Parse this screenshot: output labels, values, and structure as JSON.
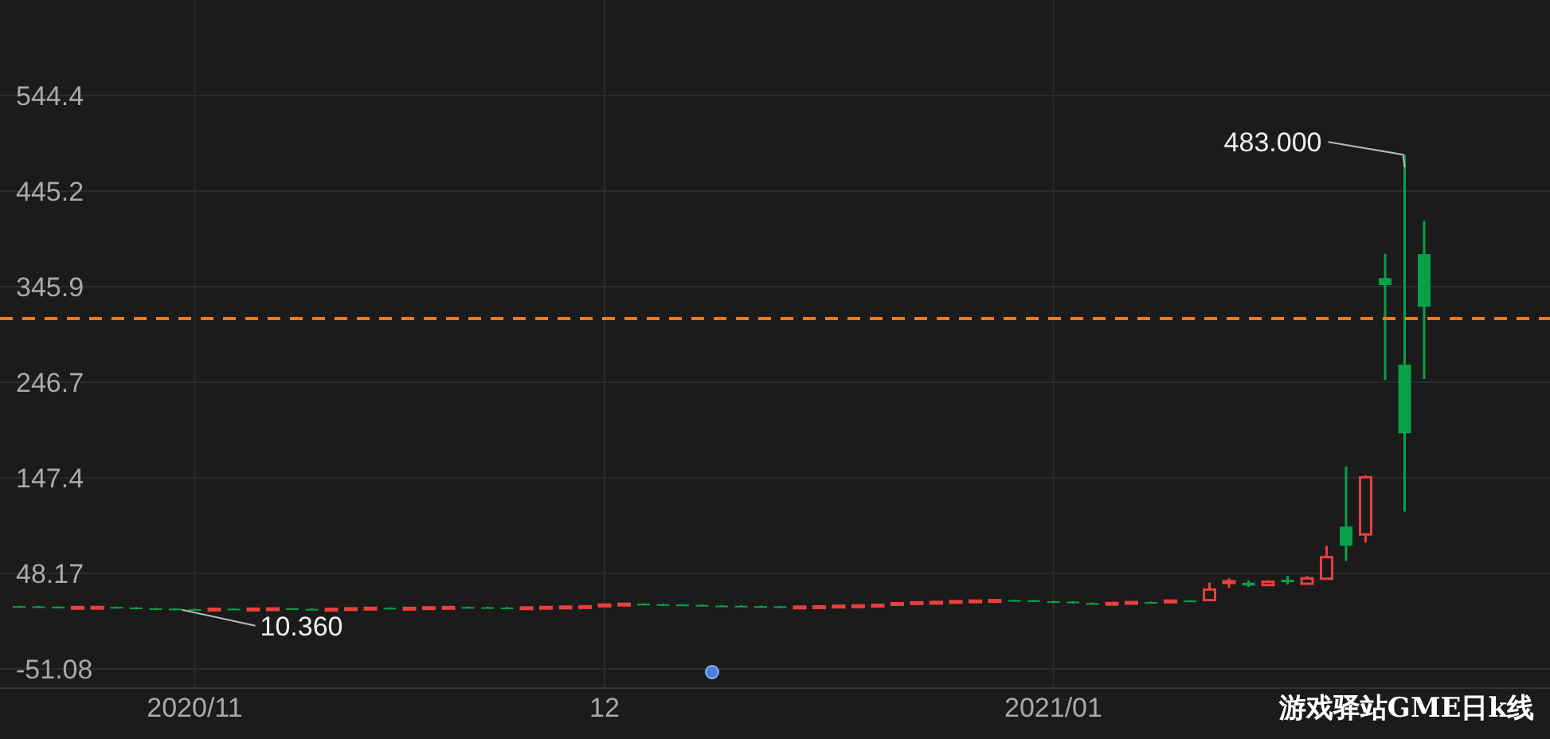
{
  "chart": {
    "chart_data": {
      "type": "candlestick",
      "ylim": [
        -70.9,
        643.6
      ],
      "grid": true,
      "categories": [
        null,
        null,
        null,
        null,
        null,
        null,
        null,
        null,
        null,
        "2020/11",
        null,
        null,
        null,
        null,
        null,
        null,
        null,
        null,
        null,
        null,
        null,
        null,
        null,
        null,
        null,
        null,
        null,
        null,
        null,
        null,
        "12",
        null,
        null,
        null,
        null,
        null,
        null,
        null,
        null,
        null,
        null,
        null,
        null,
        null,
        null,
        null,
        null,
        null,
        null,
        null,
        null,
        null,
        null,
        "2021/01",
        null,
        null,
        null,
        null,
        null,
        null,
        null,
        null,
        null,
        null,
        null,
        null,
        null,
        null,
        null,
        null,
        null,
        null,
        null
      ],
      "yticks": [
        {
          "value": 544.4,
          "label": "544.4"
        },
        {
          "value": 445.2,
          "label": "445.2"
        },
        {
          "value": 345.9,
          "label": "345.9"
        },
        {
          "value": 246.7,
          "label": "246.7"
        },
        {
          "value": 147.4,
          "label": "147.4"
        },
        {
          "value": 48.17,
          "label": "48.17"
        },
        {
          "value": -51.08,
          "label": "-51.08"
        }
      ],
      "series": [
        {
          "ohlc": [
            [
              14.2,
              14.7,
              13.4,
              13.9
            ],
            [
              13.9,
              14.4,
              13.1,
              13.6
            ],
            [
              13.6,
              14.1,
              12.5,
              13.0
            ],
            [
              13.0,
              13.7,
              12.5,
              13.2
            ],
            [
              13.2,
              13.8,
              12.7,
              13.3
            ],
            [
              13.3,
              13.8,
              12.2,
              12.7
            ],
            [
              12.7,
              13.2,
              11.3,
              11.8
            ],
            [
              11.8,
              12.3,
              11.0,
              11.5
            ],
            [
              11.5,
              12.0,
              10.5,
              11.0
            ],
            [
              11.0,
              11.5,
              10.36,
              10.9
            ],
            [
              10.9,
              11.9,
              10.4,
              11.4
            ],
            [
              11.4,
              11.9,
              10.7,
              11.2
            ],
            [
              11.2,
              12.0,
              10.7,
              11.5
            ],
            [
              11.5,
              12.3,
              11.0,
              11.8
            ],
            [
              11.8,
              12.3,
              10.8,
              11.3
            ],
            [
              11.3,
              11.8,
              10.5,
              11.0
            ],
            [
              11.0,
              11.8,
              10.5,
              11.3
            ],
            [
              11.3,
              12.4,
              10.8,
              11.9
            ],
            [
              11.9,
              12.9,
              11.4,
              12.4
            ],
            [
              12.4,
              12.9,
              11.5,
              12.0
            ],
            [
              12.0,
              12.8,
              11.5,
              12.3
            ],
            [
              12.3,
              13.4,
              11.8,
              12.9
            ],
            [
              12.9,
              13.7,
              12.4,
              13.2
            ],
            [
              13.2,
              13.7,
              12.5,
              13.0
            ],
            [
              13.0,
              13.5,
              12.2,
              12.7
            ],
            [
              12.7,
              13.2,
              12.0,
              12.5
            ],
            [
              12.5,
              13.3,
              12.0,
              12.8
            ],
            [
              12.8,
              13.8,
              12.3,
              13.3
            ],
            [
              13.3,
              14.1,
              12.8,
              13.6
            ],
            [
              13.6,
              14.5,
              13.1,
              14.0
            ],
            [
              14.0,
              16.3,
              13.5,
              15.8
            ],
            [
              15.8,
              17.1,
              15.3,
              16.6
            ],
            [
              16.6,
              17.1,
              15.6,
              16.1
            ],
            [
              16.1,
              16.6,
              15.3,
              15.8
            ],
            [
              15.8,
              16.3,
              14.9,
              15.4
            ],
            [
              15.4,
              15.9,
              14.2,
              14.7
            ],
            [
              14.7,
              15.2,
              14.0,
              14.5
            ],
            [
              14.5,
              15.0,
              13.7,
              14.2
            ],
            [
              14.2,
              14.7,
              13.4,
              13.9
            ],
            [
              13.9,
              14.4,
              13.0,
              13.5
            ],
            [
              13.5,
              14.1,
              13.0,
              13.6
            ],
            [
              13.6,
              14.4,
              13.1,
              13.9
            ],
            [
              13.9,
              15.1,
              13.4,
              14.6
            ],
            [
              14.6,
              15.4,
              14.1,
              14.9
            ],
            [
              14.9,
              16.0,
              14.4,
              15.5
            ],
            [
              15.5,
              17.7,
              15.0,
              17.2
            ],
            [
              17.2,
              18.6,
              16.7,
              18.1
            ],
            [
              18.1,
              19.0,
              17.6,
              18.5
            ],
            [
              18.5,
              19.9,
              18.0,
              19.4
            ],
            [
              19.4,
              20.4,
              18.9,
              19.9
            ],
            [
              19.9,
              20.9,
              19.4,
              20.4
            ],
            [
              20.4,
              20.9,
              19.7,
              20.2
            ],
            [
              20.2,
              20.7,
              18.7,
              19.2
            ],
            [
              19.2,
              19.7,
              18.3,
              18.8
            ],
            [
              18.8,
              19.3,
              16.8,
              17.3
            ],
            [
              17.3,
              17.8,
              16.5,
              17.0
            ],
            [
              17.0,
              17.9,
              16.5,
              17.4
            ],
            [
              17.4,
              18.9,
              16.9,
              18.4
            ],
            [
              18.4,
              18.9,
              17.6,
              18.1
            ],
            [
              18.1,
              20.4,
              17.6,
              19.9
            ],
            [
              19.9,
              20.4,
              19.4,
              19.9
            ],
            [
              20.4,
              38.6,
              19.5,
              31.4
            ],
            [
              38.5,
              43.1,
              33.1,
              39.9
            ],
            [
              38.5,
              40.9,
              34.0,
              35.5
            ],
            [
              36.0,
              41.0,
              35.0,
              39.4
            ],
            [
              41.6,
              45.5,
              36.6,
              39.1
            ],
            [
              37.4,
              45.5,
              36.6,
              43.0
            ],
            [
              42.6,
              76.8,
              42.3,
              65.0
            ],
            [
              96.7,
              159.2,
              61.1,
              76.8
            ],
            [
              88.6,
              150.0,
              80.2,
              147.9
            ],
            [
              354.8,
              380.0,
              249.0,
              347.5
            ],
            [
              265.0,
              483.0,
              112.3,
              193.6
            ],
            [
              379.7,
              414.0,
              250.0,
              325.0
            ]
          ]
        }
      ],
      "annotations": [
        "483.000",
        "10.360"
      ],
      "ref_lines": [
        {
          "axis": "y",
          "value": 312.8,
          "color": "#f07a1a"
        }
      ]
    },
    "caption": "游戏驿站GME日k线"
  }
}
